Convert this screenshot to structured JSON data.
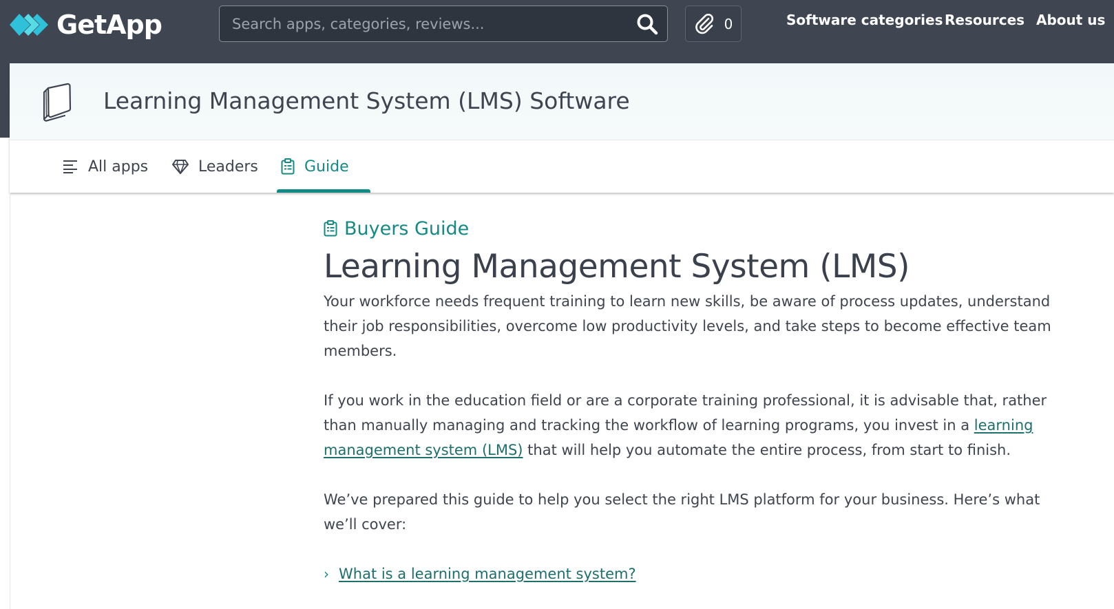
{
  "header": {
    "brand": "GetApp",
    "search_placeholder": "Search apps, categories, reviews...",
    "clip_count": "0",
    "nav": [
      "Software categories",
      "Resources",
      "About us"
    ]
  },
  "category": {
    "title": "Learning Management System (LMS) Software",
    "tabs": [
      {
        "label": "All apps",
        "icon": "list-icon"
      },
      {
        "label": "Leaders",
        "icon": "diamond-icon"
      },
      {
        "label": "Guide",
        "icon": "clipboard-icon",
        "active": true
      }
    ]
  },
  "guide": {
    "tag": "Buyers Guide",
    "title": "Learning Management System (LMS)",
    "p1": "Your workforce needs frequent training to learn new skills, be aware of process updates, understand their job responsibilities, overcome low productivity levels, and take steps to become effective team members.",
    "p2_before": "If you work in the education field or are a corporate training professional, it is advisable that, rather than manually managing and tracking the workflow of learning programs, you invest in a ",
    "p2_link": "learning management system (LMS)",
    "p2_after": " that will help you automate the entire process, from start to finish.",
    "p3": "We’ve prepared this guide to help you select the right LMS platform for your business. Here’s what we’ll cover:",
    "toc": [
      "What is a learning management system?"
    ]
  },
  "colors": {
    "header_bg": "#3f4652",
    "accent": "#138a83",
    "text": "#3e4450",
    "logo_cyan": "#34c3d6"
  }
}
